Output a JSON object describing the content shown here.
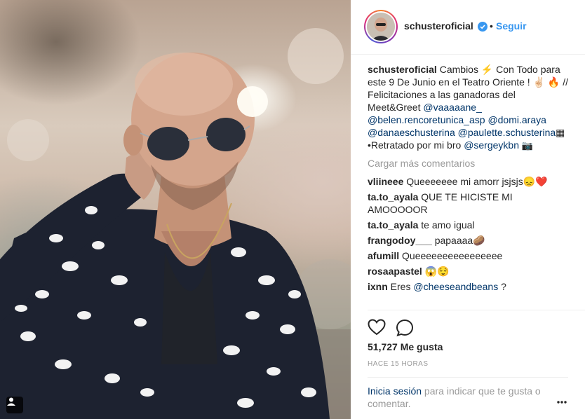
{
  "post": {
    "username": "schusteroficial",
    "follow_label": "Seguir",
    "dot": "•"
  },
  "caption": {
    "username": "schusteroficial",
    "text_1": " Cambios ⚡ Con Todo para este 9 De Junio en el Teatro Oriente ! ✌🏻 🔥 // Felicitaciones a las ganadoras del Meet&Greet ",
    "mentions": [
      "@vaaaaane_",
      "@belen.rencoretunica_asp",
      "@domi.araya",
      "@danaeschusterina",
      "@paulette.schusterina"
    ],
    "text_2": "▦",
    "text_3": "•Retratado por mi bro ",
    "mention_photo": "@sergeykbn",
    "camera": "📷"
  },
  "load_more": "Cargar más comentarios",
  "comments": [
    {
      "user": "vliineee",
      "text": " Queeeeeee mi amorr jsjsjs😞❤️"
    },
    {
      "user": "ta.to_ayala",
      "text": " QUE TE HICISTE MI AMOOOOOR"
    },
    {
      "user": "ta.to_ayala",
      "text": " te amo igual"
    },
    {
      "user": "frangodoy___",
      "text": " papaaaa🥔"
    },
    {
      "user": "afumill",
      "text": " Queeeeeeeeeeeeeeee"
    },
    {
      "user": "rosaapastel",
      "text": " 😱😌"
    },
    {
      "user": "ixnn",
      "text": " Eres ",
      "mention": "@cheeseandbeans",
      "text_after": " ?"
    }
  ],
  "likes": "51,727 Me gusta",
  "timestamp": "HACE 15 HORAS",
  "footer": {
    "login_label": "Inicia sesión",
    "rest": " para indicar que te gusta o comentar."
  },
  "icons": {
    "verified": "verified-badge-icon",
    "heart": "heart-icon",
    "comment": "comment-icon",
    "more": "more-options-icon",
    "photo_user": "user-tag-icon"
  },
  "colors": {
    "link_blue": "#3897f0",
    "mention": "#003569",
    "muted": "#999999"
  }
}
